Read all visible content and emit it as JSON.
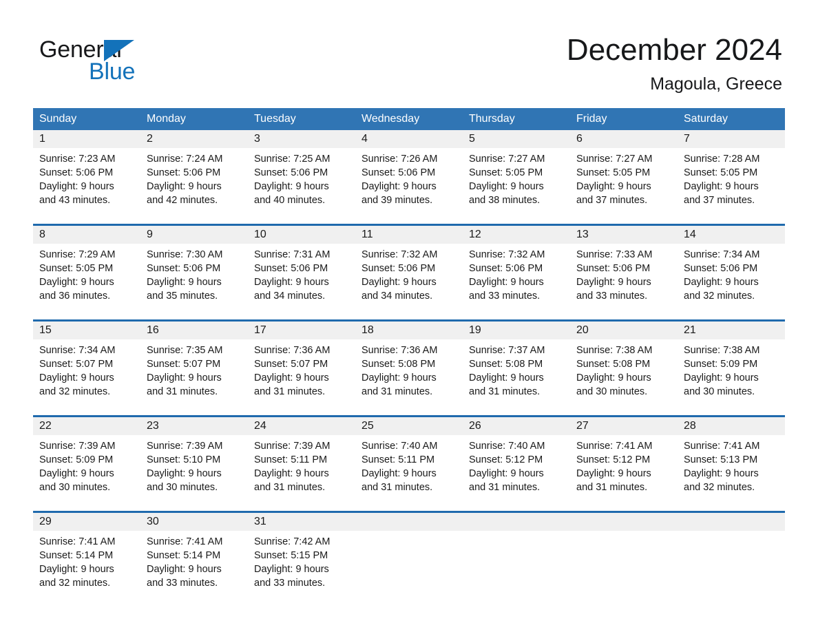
{
  "brand": {
    "name_part1": "General",
    "name_part2": "Blue",
    "accent_color": "#1372ba",
    "triangle_icon": "triangle-icon"
  },
  "header": {
    "title": "December 2024",
    "subtitle": "Magoula, Greece"
  },
  "colors": {
    "header_blue": "#3075b4",
    "separator_blue": "#1f6aad",
    "daynum_band": "#f0f0f0",
    "text": "#1a1a1a"
  },
  "weekdays": [
    "Sunday",
    "Monday",
    "Tuesday",
    "Wednesday",
    "Thursday",
    "Friday",
    "Saturday"
  ],
  "weeks": [
    {
      "days": [
        {
          "num": "1",
          "sunrise": "Sunrise: 7:23 AM",
          "sunset": "Sunset: 5:06 PM",
          "daylight1": "Daylight: 9 hours",
          "daylight2": "and 43 minutes."
        },
        {
          "num": "2",
          "sunrise": "Sunrise: 7:24 AM",
          "sunset": "Sunset: 5:06 PM",
          "daylight1": "Daylight: 9 hours",
          "daylight2": "and 42 minutes."
        },
        {
          "num": "3",
          "sunrise": "Sunrise: 7:25 AM",
          "sunset": "Sunset: 5:06 PM",
          "daylight1": "Daylight: 9 hours",
          "daylight2": "and 40 minutes."
        },
        {
          "num": "4",
          "sunrise": "Sunrise: 7:26 AM",
          "sunset": "Sunset: 5:06 PM",
          "daylight1": "Daylight: 9 hours",
          "daylight2": "and 39 minutes."
        },
        {
          "num": "5",
          "sunrise": "Sunrise: 7:27 AM",
          "sunset": "Sunset: 5:05 PM",
          "daylight1": "Daylight: 9 hours",
          "daylight2": "and 38 minutes."
        },
        {
          "num": "6",
          "sunrise": "Sunrise: 7:27 AM",
          "sunset": "Sunset: 5:05 PM",
          "daylight1": "Daylight: 9 hours",
          "daylight2": "and 37 minutes."
        },
        {
          "num": "7",
          "sunrise": "Sunrise: 7:28 AM",
          "sunset": "Sunset: 5:05 PM",
          "daylight1": "Daylight: 9 hours",
          "daylight2": "and 37 minutes."
        }
      ]
    },
    {
      "days": [
        {
          "num": "8",
          "sunrise": "Sunrise: 7:29 AM",
          "sunset": "Sunset: 5:05 PM",
          "daylight1": "Daylight: 9 hours",
          "daylight2": "and 36 minutes."
        },
        {
          "num": "9",
          "sunrise": "Sunrise: 7:30 AM",
          "sunset": "Sunset: 5:06 PM",
          "daylight1": "Daylight: 9 hours",
          "daylight2": "and 35 minutes."
        },
        {
          "num": "10",
          "sunrise": "Sunrise: 7:31 AM",
          "sunset": "Sunset: 5:06 PM",
          "daylight1": "Daylight: 9 hours",
          "daylight2": "and 34 minutes."
        },
        {
          "num": "11",
          "sunrise": "Sunrise: 7:32 AM",
          "sunset": "Sunset: 5:06 PM",
          "daylight1": "Daylight: 9 hours",
          "daylight2": "and 34 minutes."
        },
        {
          "num": "12",
          "sunrise": "Sunrise: 7:32 AM",
          "sunset": "Sunset: 5:06 PM",
          "daylight1": "Daylight: 9 hours",
          "daylight2": "and 33 minutes."
        },
        {
          "num": "13",
          "sunrise": "Sunrise: 7:33 AM",
          "sunset": "Sunset: 5:06 PM",
          "daylight1": "Daylight: 9 hours",
          "daylight2": "and 33 minutes."
        },
        {
          "num": "14",
          "sunrise": "Sunrise: 7:34 AM",
          "sunset": "Sunset: 5:06 PM",
          "daylight1": "Daylight: 9 hours",
          "daylight2": "and 32 minutes."
        }
      ]
    },
    {
      "days": [
        {
          "num": "15",
          "sunrise": "Sunrise: 7:34 AM",
          "sunset": "Sunset: 5:07 PM",
          "daylight1": "Daylight: 9 hours",
          "daylight2": "and 32 minutes."
        },
        {
          "num": "16",
          "sunrise": "Sunrise: 7:35 AM",
          "sunset": "Sunset: 5:07 PM",
          "daylight1": "Daylight: 9 hours",
          "daylight2": "and 31 minutes."
        },
        {
          "num": "17",
          "sunrise": "Sunrise: 7:36 AM",
          "sunset": "Sunset: 5:07 PM",
          "daylight1": "Daylight: 9 hours",
          "daylight2": "and 31 minutes."
        },
        {
          "num": "18",
          "sunrise": "Sunrise: 7:36 AM",
          "sunset": "Sunset: 5:08 PM",
          "daylight1": "Daylight: 9 hours",
          "daylight2": "and 31 minutes."
        },
        {
          "num": "19",
          "sunrise": "Sunrise: 7:37 AM",
          "sunset": "Sunset: 5:08 PM",
          "daylight1": "Daylight: 9 hours",
          "daylight2": "and 31 minutes."
        },
        {
          "num": "20",
          "sunrise": "Sunrise: 7:38 AM",
          "sunset": "Sunset: 5:08 PM",
          "daylight1": "Daylight: 9 hours",
          "daylight2": "and 30 minutes."
        },
        {
          "num": "21",
          "sunrise": "Sunrise: 7:38 AM",
          "sunset": "Sunset: 5:09 PM",
          "daylight1": "Daylight: 9 hours",
          "daylight2": "and 30 minutes."
        }
      ]
    },
    {
      "days": [
        {
          "num": "22",
          "sunrise": "Sunrise: 7:39 AM",
          "sunset": "Sunset: 5:09 PM",
          "daylight1": "Daylight: 9 hours",
          "daylight2": "and 30 minutes."
        },
        {
          "num": "23",
          "sunrise": "Sunrise: 7:39 AM",
          "sunset": "Sunset: 5:10 PM",
          "daylight1": "Daylight: 9 hours",
          "daylight2": "and 30 minutes."
        },
        {
          "num": "24",
          "sunrise": "Sunrise: 7:39 AM",
          "sunset": "Sunset: 5:11 PM",
          "daylight1": "Daylight: 9 hours",
          "daylight2": "and 31 minutes."
        },
        {
          "num": "25",
          "sunrise": "Sunrise: 7:40 AM",
          "sunset": "Sunset: 5:11 PM",
          "daylight1": "Daylight: 9 hours",
          "daylight2": "and 31 minutes."
        },
        {
          "num": "26",
          "sunrise": "Sunrise: 7:40 AM",
          "sunset": "Sunset: 5:12 PM",
          "daylight1": "Daylight: 9 hours",
          "daylight2": "and 31 minutes."
        },
        {
          "num": "27",
          "sunrise": "Sunrise: 7:41 AM",
          "sunset": "Sunset: 5:12 PM",
          "daylight1": "Daylight: 9 hours",
          "daylight2": "and 31 minutes."
        },
        {
          "num": "28",
          "sunrise": "Sunrise: 7:41 AM",
          "sunset": "Sunset: 5:13 PM",
          "daylight1": "Daylight: 9 hours",
          "daylight2": "and 32 minutes."
        }
      ]
    },
    {
      "days": [
        {
          "num": "29",
          "sunrise": "Sunrise: 7:41 AM",
          "sunset": "Sunset: 5:14 PM",
          "daylight1": "Daylight: 9 hours",
          "daylight2": "and 32 minutes."
        },
        {
          "num": "30",
          "sunrise": "Sunrise: 7:41 AM",
          "sunset": "Sunset: 5:14 PM",
          "daylight1": "Daylight: 9 hours",
          "daylight2": "and 33 minutes."
        },
        {
          "num": "31",
          "sunrise": "Sunrise: 7:42 AM",
          "sunset": "Sunset: 5:15 PM",
          "daylight1": "Daylight: 9 hours",
          "daylight2": "and 33 minutes."
        },
        {
          "num": "",
          "sunrise": "",
          "sunset": "",
          "daylight1": "",
          "daylight2": ""
        },
        {
          "num": "",
          "sunrise": "",
          "sunset": "",
          "daylight1": "",
          "daylight2": ""
        },
        {
          "num": "",
          "sunrise": "",
          "sunset": "",
          "daylight1": "",
          "daylight2": ""
        },
        {
          "num": "",
          "sunrise": "",
          "sunset": "",
          "daylight1": "",
          "daylight2": ""
        }
      ]
    }
  ]
}
